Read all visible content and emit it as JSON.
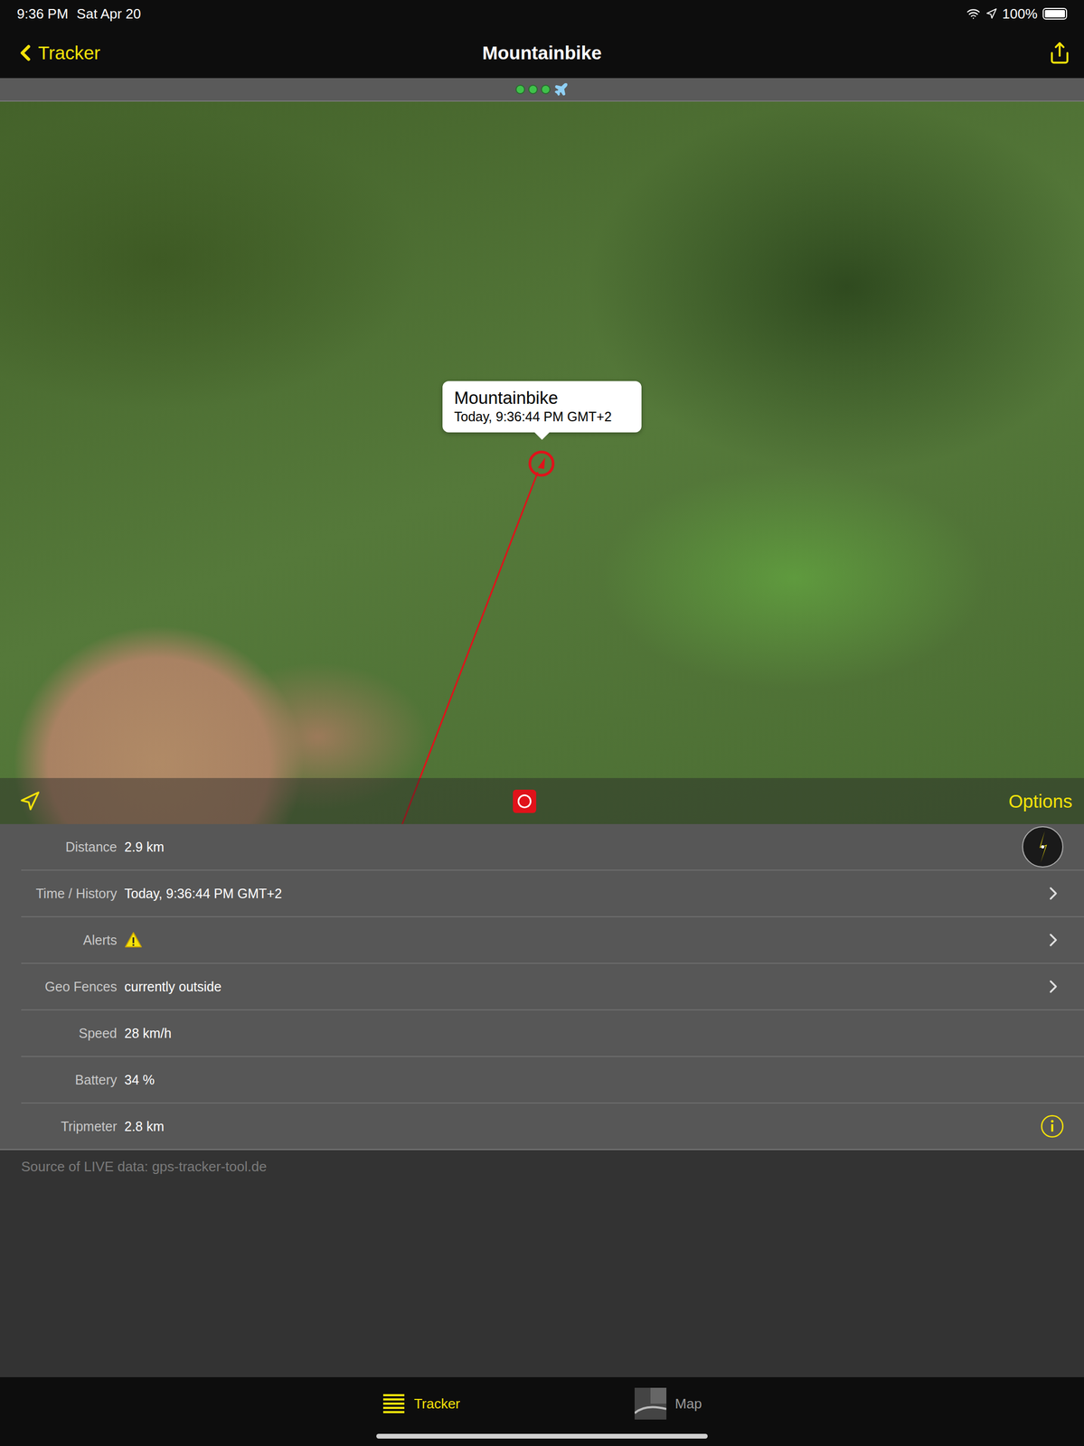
{
  "status_bar": {
    "time": "9:36 PM",
    "date": "Sat Apr 20",
    "battery": "100%",
    "battery_level": 1.0
  },
  "nav": {
    "back": "Tracker",
    "title": "Mountainbike"
  },
  "connection": {
    "dots": [
      {
        "on": true,
        "color": "#3fc24a"
      },
      {
        "on": true,
        "color": "#3fc24a"
      },
      {
        "on": true,
        "color": "#3fc24a"
      }
    ]
  },
  "map": {
    "callout": {
      "title": "Mountainbike",
      "subtitle": "Today, 9:36:44 PM GMT+2"
    },
    "options": "Options",
    "recording": true
  },
  "details": [
    {
      "label": "Distance",
      "value": "2.9 km",
      "kind": "compass"
    },
    {
      "label": "Time / History",
      "value": "Today, 9:36:44 PM GMT+2",
      "kind": "link"
    },
    {
      "label": "Alerts",
      "value": "",
      "kind": "alert"
    },
    {
      "label": "Geo Fences",
      "value": "currently outside",
      "kind": "link"
    },
    {
      "label": "Speed",
      "value": "28 km/h",
      "kind": "plain"
    },
    {
      "label": "Battery",
      "value": "34 %",
      "kind": "plain"
    },
    {
      "label": "Tripmeter",
      "value": "2.8 km",
      "kind": "info"
    }
  ],
  "source": "Source of LIVE data: gps-tracker-tool.de",
  "tabs": [
    {
      "label": "Tracker",
      "selected": true
    },
    {
      "label": "Map",
      "selected": false
    }
  ]
}
